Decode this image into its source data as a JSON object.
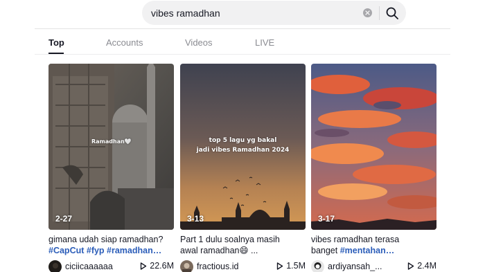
{
  "search": {
    "query": "vibes ramadhan"
  },
  "tabs": [
    {
      "label": "Top",
      "active": true
    },
    {
      "label": "Accounts",
      "active": false
    },
    {
      "label": "Videos",
      "active": false
    },
    {
      "label": "LIVE",
      "active": false
    }
  ],
  "videos": [
    {
      "date": "2-27",
      "overlay": "Ramadhan🤍",
      "caption": "gimana udah siap ramadhan? ",
      "hashtags": "#CapCut #fyp #ramadhan…",
      "username": "ciciicaaaaaa",
      "views": "22.6M",
      "avatar_icon": "dark-avatar"
    },
    {
      "date": "3-13",
      "overlay_line1": "top 5 lagu yg bakal",
      "overlay_line2": "jadi vibes Ramadhan 2024",
      "caption_line1": "Part 1 dulu soalnya masih",
      "caption_line2": "awal ramadhan😄 ...",
      "username": "fractious.id",
      "views": "1.5M",
      "avatar_icon": "photo-avatar"
    },
    {
      "date": "3-17",
      "caption_line1": "vibes ramadhan terasa",
      "caption_line2_text": "banget ",
      "hashtags": "#mentahan…",
      "username": "ardiyansah_...",
      "views": "2.4M",
      "avatar_icon": "character-avatar"
    }
  ],
  "colors": {
    "hashtag": "#2b5db9",
    "search_bg": "#f1f1f2",
    "text": "#161823",
    "muted": "#8a8b91"
  }
}
